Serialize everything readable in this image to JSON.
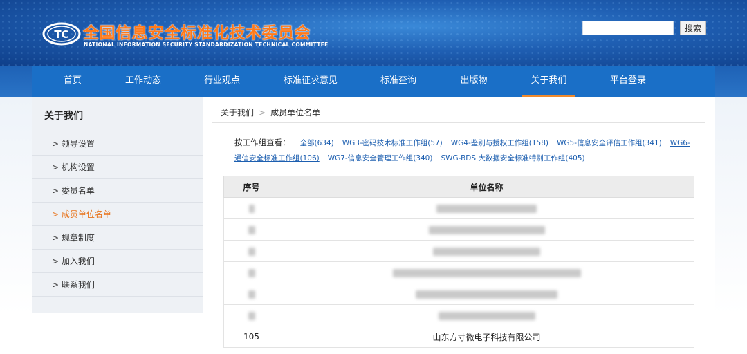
{
  "header": {
    "title": "全国信息安全标准化技术委员会",
    "subtitle": "NATIONAL INFORMATION SECURITY STANDARDIZATION TECHNICAL COMMITTEE",
    "search_placeholder": "",
    "search_button": "搜索",
    "logo_text": "TC"
  },
  "nav": {
    "items": [
      {
        "label": "首页"
      },
      {
        "label": "工作动态"
      },
      {
        "label": "行业观点"
      },
      {
        "label": "标准征求意见"
      },
      {
        "label": "标准查询"
      },
      {
        "label": "出版物"
      },
      {
        "label": "关于我们",
        "active": true
      },
      {
        "label": "平台登录"
      }
    ]
  },
  "sidebar": {
    "title": "关于我们",
    "items": [
      {
        "label": "> 领导设置"
      },
      {
        "label": "> 机构设置"
      },
      {
        "label": "> 委员名单"
      },
      {
        "label": "> 成员单位名单",
        "active": true
      },
      {
        "label": "> 规章制度"
      },
      {
        "label": "> 加入我们"
      },
      {
        "label": "> 联系我们"
      }
    ]
  },
  "breadcrumb": {
    "parent": "关于我们",
    "separator": ">",
    "current": "成员单位名单"
  },
  "filter": {
    "label": "按工作组查看：",
    "links": [
      "全部(634)",
      "WG3-密码技术标准工作组(57)",
      "WG4-鉴别与授权工作组(158)",
      "WG5-信息安全评估工作组(341)",
      "WG6-通信安全标准工作组(106)",
      "WG7-信息安全管理工作组(340)",
      "SWG-BDS 大数据安全标准特别工作组(405)"
    ]
  },
  "table": {
    "headers": [
      "序号",
      "单位名称"
    ],
    "rows": [
      {
        "no": "",
        "name": "",
        "blurred": true
      },
      {
        "no": "",
        "name": "",
        "blurred": true
      },
      {
        "no": "",
        "name": "",
        "blurred": true
      },
      {
        "no": "",
        "name": "",
        "blurred": true
      },
      {
        "no": "",
        "name": "",
        "blurred": true
      },
      {
        "no": "",
        "name": "",
        "blurred": true
      },
      {
        "no": "105",
        "name": "山东方寸微电子科技有限公司",
        "blurred": false
      }
    ]
  },
  "colors": {
    "brand_orange": "#ff7a1a",
    "nav_blue": "#1a6fc7",
    "link_blue": "#1d5fb0",
    "active_orange": "#e8741c"
  }
}
